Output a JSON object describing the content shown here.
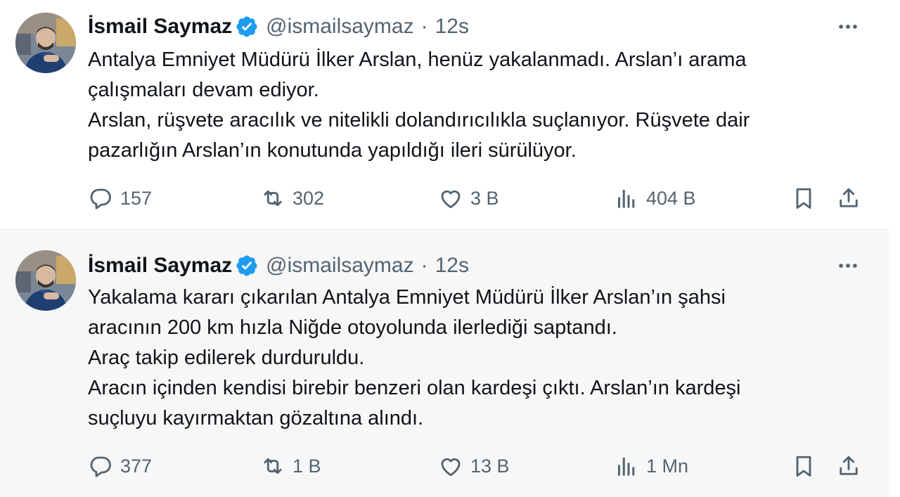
{
  "tweets": [
    {
      "author_name": "İsmail Saymaz",
      "handle": "@ismailsaymaz",
      "separator": "·",
      "time": "12s",
      "lines": [
        "Antalya Emniyet Müdürü İlker Arslan, henüz yakalanmadı. Arslan’ı arama",
        "çalışmaları devam ediyor.",
        "Arslan, rüşvete aracılık ve nitelikli dolandırıcılıkla suçlanıyor. Rüşvete dair",
        "pazarlığın Arslan’ın konutunda yapıldığı ileri sürülüyor."
      ],
      "stats": {
        "replies": "157",
        "reposts": "302",
        "likes": "3 B",
        "views": "404 B"
      }
    },
    {
      "author_name": "İsmail Saymaz",
      "handle": "@ismailsaymaz",
      "separator": "·",
      "time": "12s",
      "lines": [
        "Yakalama kararı çıkarılan Antalya Emniyet Müdürü İlker Arslan’ın şahsi",
        "aracının 200 km hızla Niğde otoyolunda ilerlediği saptandı.",
        "Araç takip edilerek durduruldu.",
        "Aracın içinden kendisi birebir benzeri olan kardeşi çıktı. Arslan’ın kardeşi",
        "suçluyu kayırmaktan gözaltına alındı."
      ],
      "stats": {
        "replies": "377",
        "reposts": "1 B",
        "likes": "13 B",
        "views": "1 Mn"
      }
    }
  ],
  "icons": {
    "verified": "verified-badge-icon",
    "more": "more-options-icon",
    "reply": "reply-icon",
    "repost": "repost-icon",
    "like": "like-icon",
    "views": "views-icon",
    "bookmark": "bookmark-icon",
    "share": "share-icon"
  },
  "colors": {
    "accent_verified": "#1d9bf0",
    "secondary_text": "#536471",
    "primary_text": "#0f1419"
  }
}
